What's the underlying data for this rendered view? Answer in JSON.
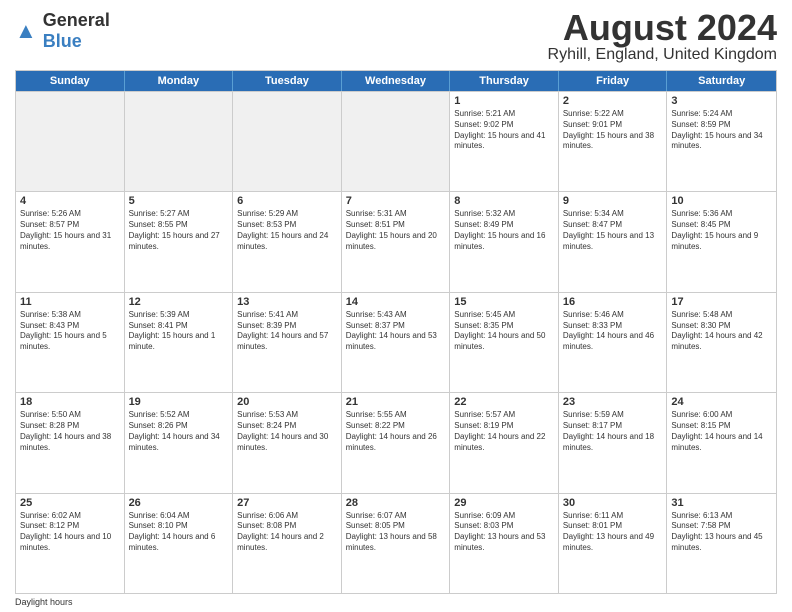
{
  "header": {
    "logo_general": "General",
    "logo_blue": "Blue",
    "title": "August 2024",
    "subtitle": "Ryhill, England, United Kingdom"
  },
  "days_of_week": [
    "Sunday",
    "Monday",
    "Tuesday",
    "Wednesday",
    "Thursday",
    "Friday",
    "Saturday"
  ],
  "weeks": [
    [
      {
        "day": "",
        "info": "",
        "shaded": true
      },
      {
        "day": "",
        "info": "",
        "shaded": true
      },
      {
        "day": "",
        "info": "",
        "shaded": true
      },
      {
        "day": "",
        "info": "",
        "shaded": true
      },
      {
        "day": "1",
        "info": "Sunrise: 5:21 AM\nSunset: 9:02 PM\nDaylight: 15 hours and 41 minutes."
      },
      {
        "day": "2",
        "info": "Sunrise: 5:22 AM\nSunset: 9:01 PM\nDaylight: 15 hours and 38 minutes."
      },
      {
        "day": "3",
        "info": "Sunrise: 5:24 AM\nSunset: 8:59 PM\nDaylight: 15 hours and 34 minutes."
      }
    ],
    [
      {
        "day": "4",
        "info": "Sunrise: 5:26 AM\nSunset: 8:57 PM\nDaylight: 15 hours and 31 minutes."
      },
      {
        "day": "5",
        "info": "Sunrise: 5:27 AM\nSunset: 8:55 PM\nDaylight: 15 hours and 27 minutes."
      },
      {
        "day": "6",
        "info": "Sunrise: 5:29 AM\nSunset: 8:53 PM\nDaylight: 15 hours and 24 minutes."
      },
      {
        "day": "7",
        "info": "Sunrise: 5:31 AM\nSunset: 8:51 PM\nDaylight: 15 hours and 20 minutes."
      },
      {
        "day": "8",
        "info": "Sunrise: 5:32 AM\nSunset: 8:49 PM\nDaylight: 15 hours and 16 minutes."
      },
      {
        "day": "9",
        "info": "Sunrise: 5:34 AM\nSunset: 8:47 PM\nDaylight: 15 hours and 13 minutes."
      },
      {
        "day": "10",
        "info": "Sunrise: 5:36 AM\nSunset: 8:45 PM\nDaylight: 15 hours and 9 minutes."
      }
    ],
    [
      {
        "day": "11",
        "info": "Sunrise: 5:38 AM\nSunset: 8:43 PM\nDaylight: 15 hours and 5 minutes."
      },
      {
        "day": "12",
        "info": "Sunrise: 5:39 AM\nSunset: 8:41 PM\nDaylight: 15 hours and 1 minute."
      },
      {
        "day": "13",
        "info": "Sunrise: 5:41 AM\nSunset: 8:39 PM\nDaylight: 14 hours and 57 minutes."
      },
      {
        "day": "14",
        "info": "Sunrise: 5:43 AM\nSunset: 8:37 PM\nDaylight: 14 hours and 53 minutes."
      },
      {
        "day": "15",
        "info": "Sunrise: 5:45 AM\nSunset: 8:35 PM\nDaylight: 14 hours and 50 minutes."
      },
      {
        "day": "16",
        "info": "Sunrise: 5:46 AM\nSunset: 8:33 PM\nDaylight: 14 hours and 46 minutes."
      },
      {
        "day": "17",
        "info": "Sunrise: 5:48 AM\nSunset: 8:30 PM\nDaylight: 14 hours and 42 minutes."
      }
    ],
    [
      {
        "day": "18",
        "info": "Sunrise: 5:50 AM\nSunset: 8:28 PM\nDaylight: 14 hours and 38 minutes."
      },
      {
        "day": "19",
        "info": "Sunrise: 5:52 AM\nSunset: 8:26 PM\nDaylight: 14 hours and 34 minutes."
      },
      {
        "day": "20",
        "info": "Sunrise: 5:53 AM\nSunset: 8:24 PM\nDaylight: 14 hours and 30 minutes."
      },
      {
        "day": "21",
        "info": "Sunrise: 5:55 AM\nSunset: 8:22 PM\nDaylight: 14 hours and 26 minutes."
      },
      {
        "day": "22",
        "info": "Sunrise: 5:57 AM\nSunset: 8:19 PM\nDaylight: 14 hours and 22 minutes."
      },
      {
        "day": "23",
        "info": "Sunrise: 5:59 AM\nSunset: 8:17 PM\nDaylight: 14 hours and 18 minutes."
      },
      {
        "day": "24",
        "info": "Sunrise: 6:00 AM\nSunset: 8:15 PM\nDaylight: 14 hours and 14 minutes."
      }
    ],
    [
      {
        "day": "25",
        "info": "Sunrise: 6:02 AM\nSunset: 8:12 PM\nDaylight: 14 hours and 10 minutes."
      },
      {
        "day": "26",
        "info": "Sunrise: 6:04 AM\nSunset: 8:10 PM\nDaylight: 14 hours and 6 minutes."
      },
      {
        "day": "27",
        "info": "Sunrise: 6:06 AM\nSunset: 8:08 PM\nDaylight: 14 hours and 2 minutes."
      },
      {
        "day": "28",
        "info": "Sunrise: 6:07 AM\nSunset: 8:05 PM\nDaylight: 13 hours and 58 minutes."
      },
      {
        "day": "29",
        "info": "Sunrise: 6:09 AM\nSunset: 8:03 PM\nDaylight: 13 hours and 53 minutes."
      },
      {
        "day": "30",
        "info": "Sunrise: 6:11 AM\nSunset: 8:01 PM\nDaylight: 13 hours and 49 minutes."
      },
      {
        "day": "31",
        "info": "Sunrise: 6:13 AM\nSunset: 7:58 PM\nDaylight: 13 hours and 45 minutes."
      }
    ]
  ],
  "footer": "Daylight hours"
}
